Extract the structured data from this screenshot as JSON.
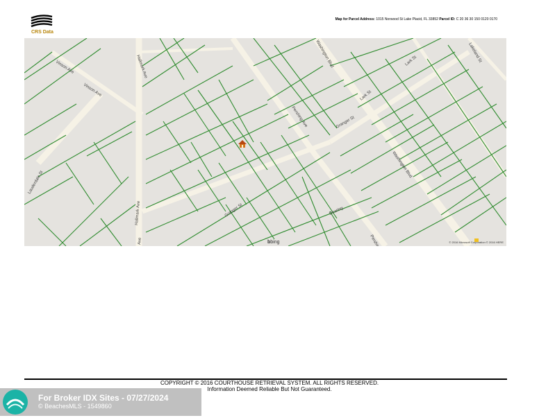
{
  "header": {
    "brand": "CRS Data",
    "map_for_label": "Map for Parcel Address:",
    "address": "1015 Norwood St Lake Placid, FL 33852",
    "parcel_id_label": "Parcel ID:",
    "parcel_id": "C 20 36 30 150 0120 0170"
  },
  "map": {
    "streets": [
      "Vinson Ave",
      "Vinson Ave",
      "Hallmark Ave",
      "Hallmark Ave",
      "Pershing Ave",
      "Granger St",
      "Washington Blvd",
      "Lark St",
      "Lark St",
      "Lakeland St",
      "Warning St",
      "Burlingame Blvd",
      "Lauderdale St",
      "Kingston Blvd",
      "Dearing",
      "Pershing",
      "Ave",
      "Ave"
    ],
    "bing_label": "bing",
    "attribution": "© 2016 Microsoft Corporation  © 2016 HERE"
  },
  "footer": {
    "copyright": "COPYRIGHT © 2016 COURTHOUSE RETRIEVAL SYSTEM. ALL RIGHTS RESERVED.",
    "disclaimer": "Information Deemed Reliable But Not Guaranteed."
  },
  "watermark": {
    "line1": "For Broker IDX Sites - 07/27/2024",
    "line2": "© BeachesMLS - 1549860"
  },
  "colors": {
    "parcel_line": "#2e8b2e",
    "road": "#f4f0e4",
    "background": "#e5e3df",
    "marker": "#d4721a"
  },
  "icons": [
    "house-marker-icon",
    "bing-logo-icon",
    "crs-logo-icon"
  ]
}
